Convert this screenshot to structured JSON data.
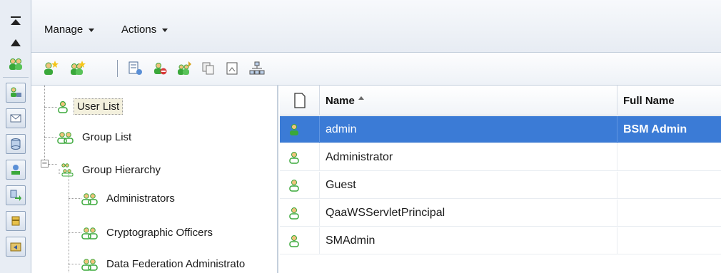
{
  "menu": {
    "manage_label": "Manage",
    "actions_label": "Actions"
  },
  "tree": {
    "nodes": [
      {
        "label": "User List",
        "icon": "user-icon",
        "selected": true
      },
      {
        "label": "Group List",
        "icon": "group-icon"
      },
      {
        "label": "Group Hierarchy",
        "icon": "group-hierarchy-icon",
        "expander": "−"
      },
      {
        "label": "Administrators",
        "icon": "group-icon"
      },
      {
        "label": "Cryptographic Officers",
        "icon": "group-icon"
      },
      {
        "label": "Data Federation Administrato",
        "icon": "group-icon"
      }
    ]
  },
  "grid": {
    "columns": [
      "",
      "Name",
      "Full Name"
    ],
    "rows": [
      {
        "name": "admin",
        "full_name": "BSM Admin",
        "selected": true
      },
      {
        "name": "Administrator",
        "full_name": ""
      },
      {
        "name": "Guest",
        "full_name": ""
      },
      {
        "name": "QaaWSServletPrincipal",
        "full_name": ""
      },
      {
        "name": "SMAdmin",
        "full_name": ""
      }
    ]
  },
  "colors": {
    "selection": "#3b7bd6",
    "user_green": "#3aa83a",
    "user_skin": "#f1c27d"
  }
}
